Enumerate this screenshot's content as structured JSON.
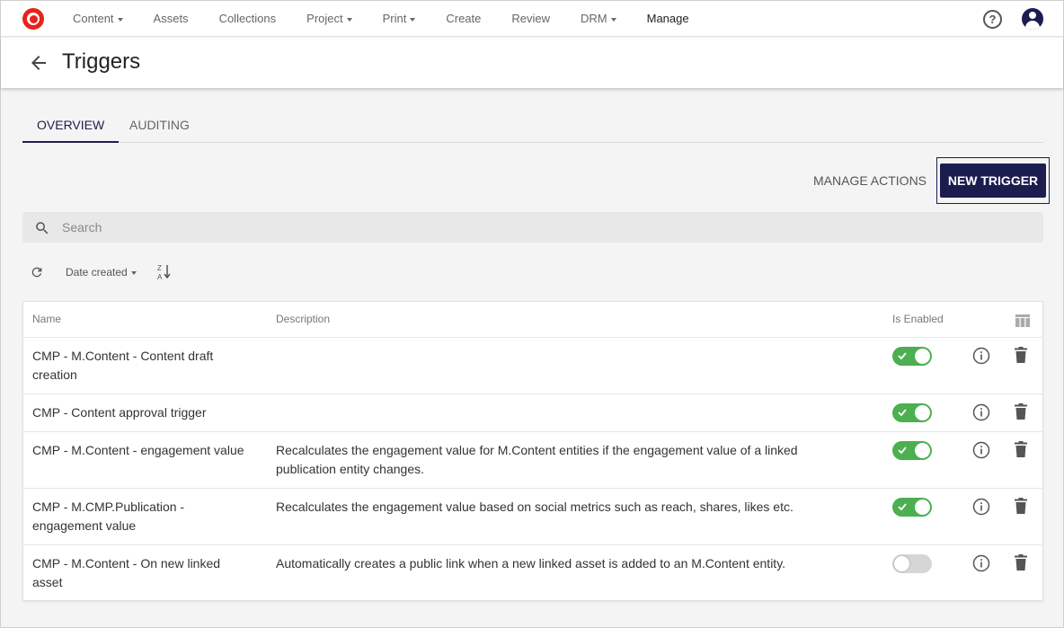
{
  "nav": {
    "items": [
      {
        "label": "Content",
        "has_caret": true
      },
      {
        "label": "Assets",
        "has_caret": false
      },
      {
        "label": "Collections",
        "has_caret": false
      },
      {
        "label": "Project",
        "has_caret": true
      },
      {
        "label": "Print",
        "has_caret": true
      },
      {
        "label": "Create",
        "has_caret": false
      },
      {
        "label": "Review",
        "has_caret": false
      },
      {
        "label": "DRM",
        "has_caret": true
      },
      {
        "label": "Manage",
        "has_caret": false,
        "active": true
      }
    ],
    "help_glyph": "?"
  },
  "page": {
    "title": "Triggers"
  },
  "tabs": [
    {
      "label": "OVERVIEW",
      "active": true
    },
    {
      "label": "AUDITING",
      "active": false
    }
  ],
  "actions": {
    "manage_actions_label": "MANAGE ACTIONS",
    "new_trigger_label": "NEW TRIGGER"
  },
  "search": {
    "placeholder": "Search",
    "value": ""
  },
  "sort": {
    "field_label": "Date created",
    "order_icon": "sort-z-a-icon"
  },
  "table": {
    "columns": {
      "name": "Name",
      "description": "Description",
      "enabled": "Is Enabled"
    },
    "rows": [
      {
        "name": "CMP - M.Content - Content draft creation",
        "description": "",
        "enabled": true
      },
      {
        "name": "CMP - Content approval trigger",
        "description": "",
        "enabled": true
      },
      {
        "name": "CMP - M.Content - engagement value",
        "description": "Recalculates the engagement value for M.Content entities if the engagement value of a linked publication entity changes.",
        "enabled": true
      },
      {
        "name": "CMP - M.CMP.Publication - engagement value",
        "description": "Recalculates the engagement value based on social metrics such as reach, shares, likes etc.",
        "enabled": true
      },
      {
        "name": "CMP - M.Content - On new linked asset",
        "description": "Automatically creates a public link when a new linked asset is added to an M.Content entity.",
        "enabled": false
      }
    ]
  },
  "colors": {
    "brand": "#e8231c",
    "primary": "#1c1d4f",
    "toggle_on": "#4caf50",
    "toggle_off": "#d6d6d6"
  }
}
